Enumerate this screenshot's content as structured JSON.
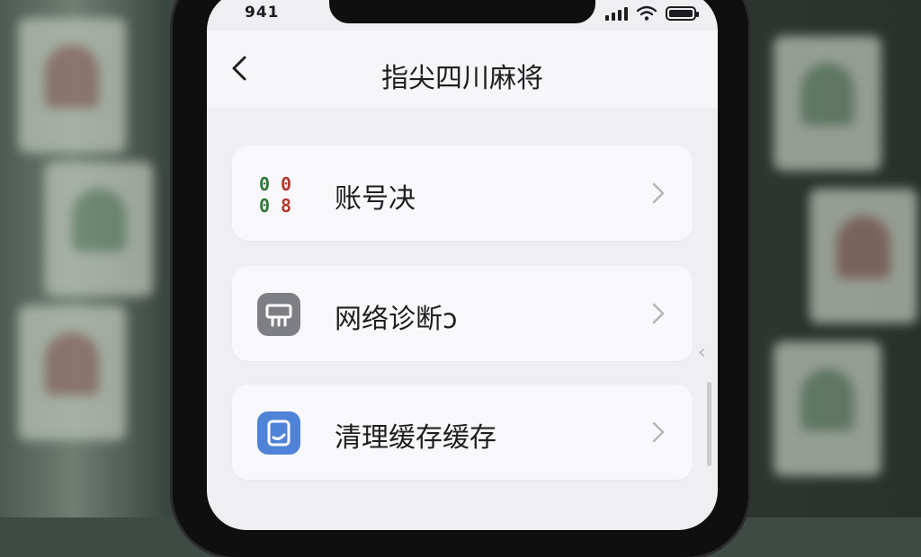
{
  "status": {
    "time": "941"
  },
  "nav": {
    "title": "指尖四川麻将"
  },
  "items": [
    {
      "label": "账号决",
      "icon": "mahjong-tiles-icon"
    },
    {
      "label": "网络诊断ↄ",
      "icon": "network-diagnosis-icon"
    },
    {
      "label": "清理缓存缓存",
      "icon": "clean-cache-icon"
    }
  ],
  "colors": {
    "accent_blue": "#4f83d8",
    "icon_gray": "#7d7f84",
    "red": "#b23a2f",
    "green": "#2f7a3b"
  }
}
